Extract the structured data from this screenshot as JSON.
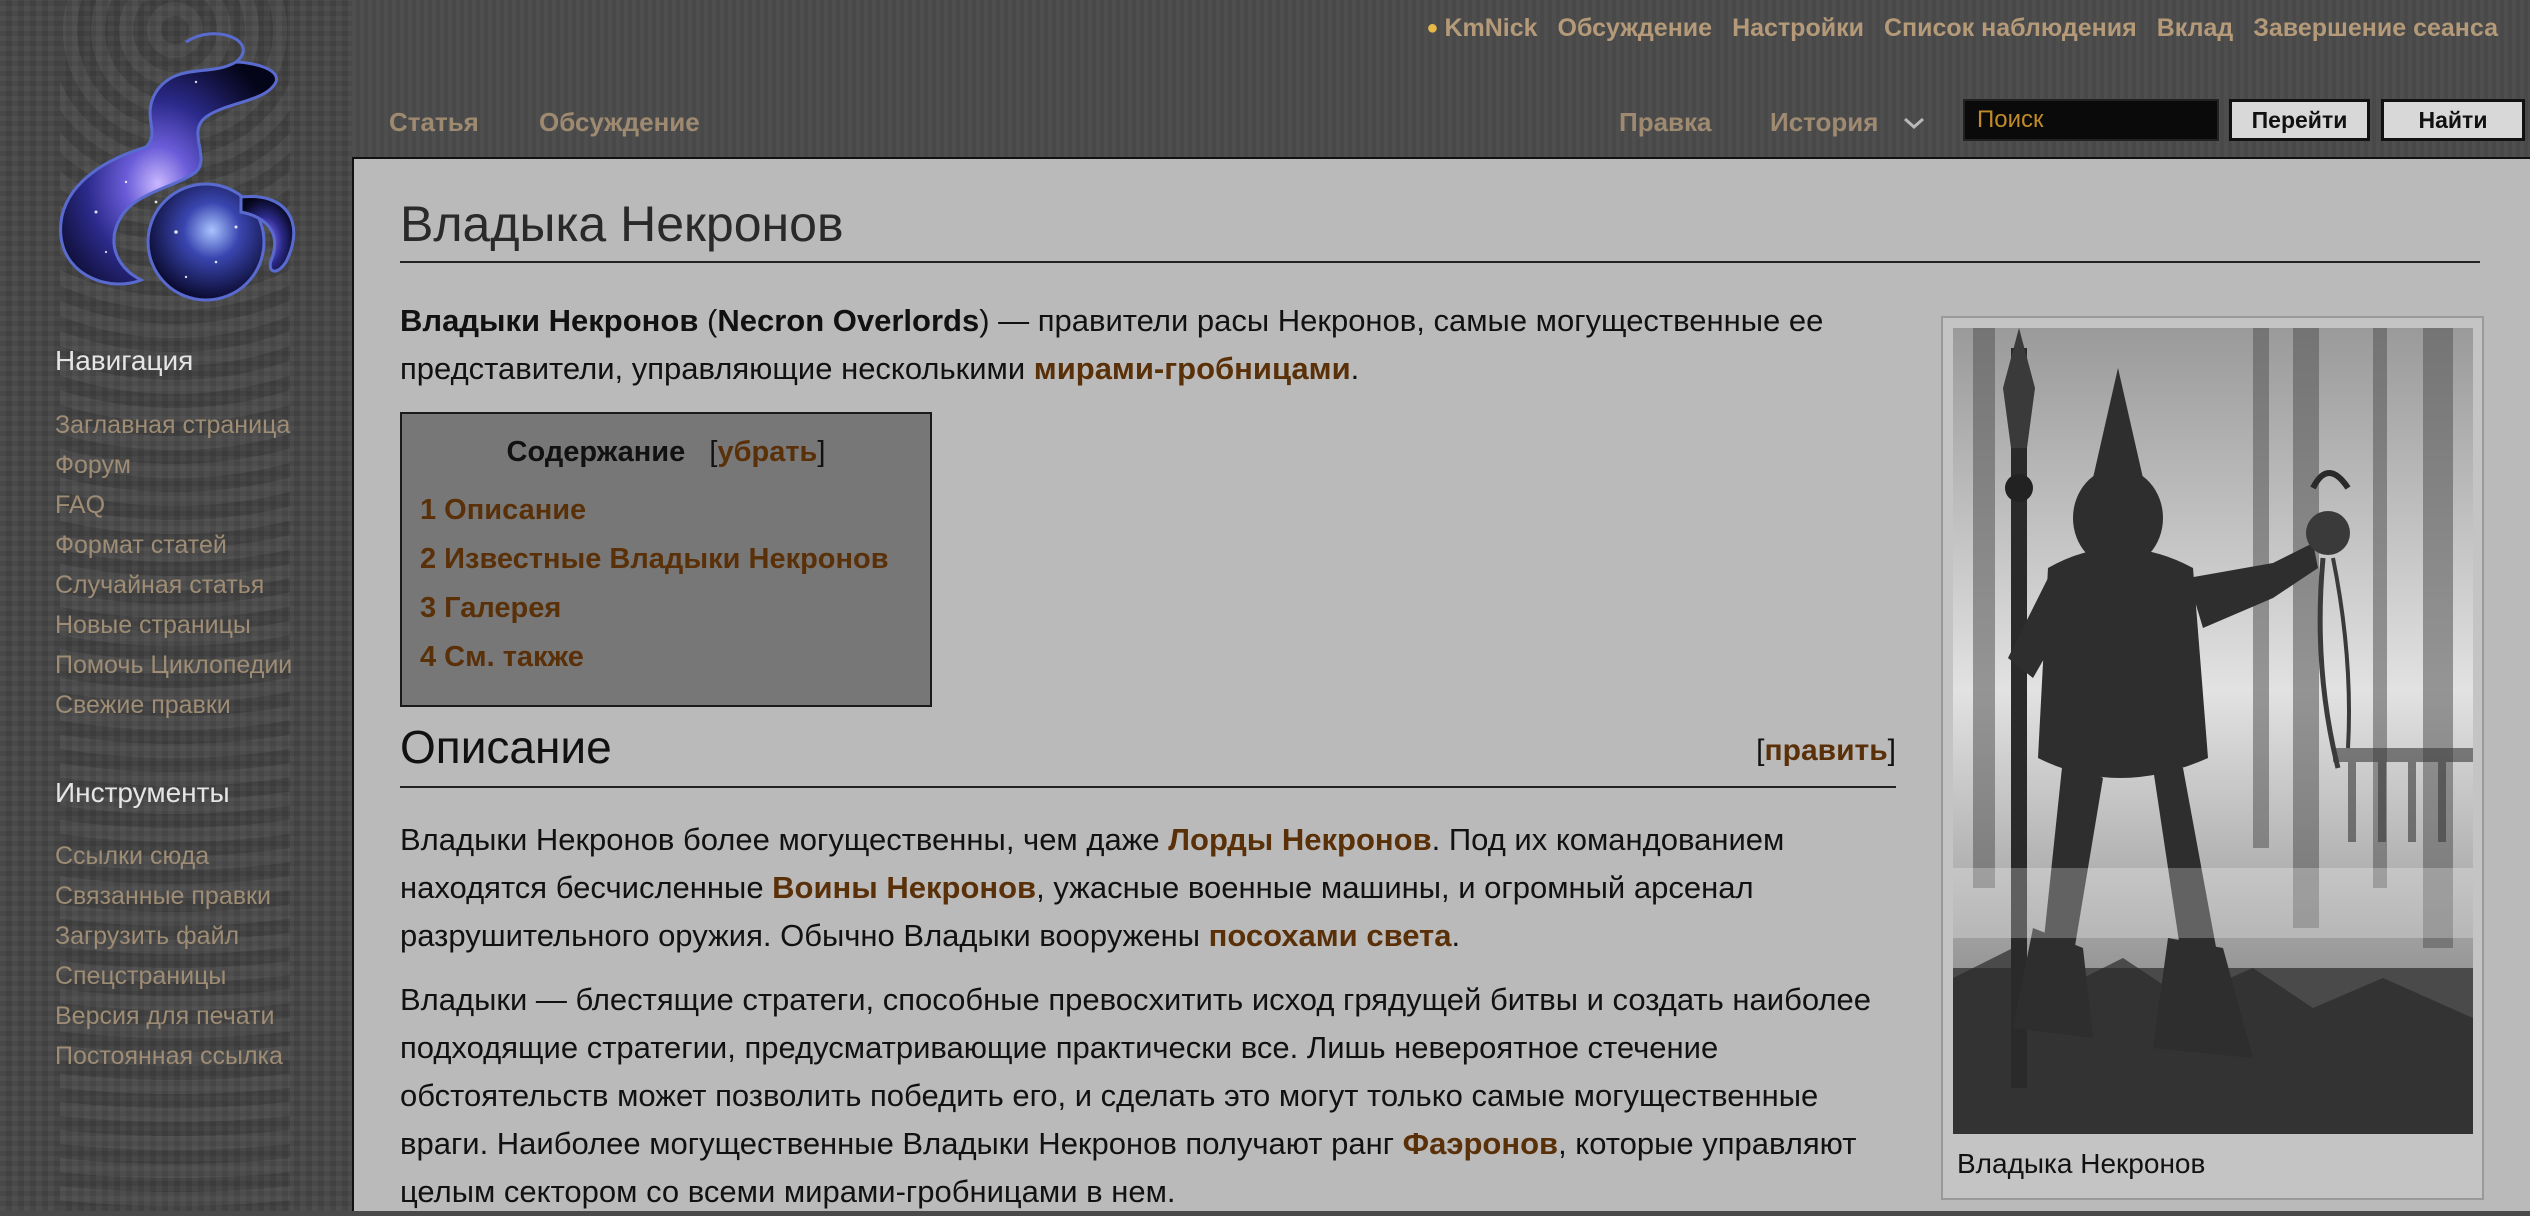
{
  "personal": {
    "username": "KmNick",
    "talk": "Обсуждение",
    "preferences": "Настройки",
    "watchlist": "Список наблюдения",
    "contributions": "Вклад",
    "logout": "Завершение сеанса"
  },
  "tabs": {
    "article": "Статья",
    "discussion": "Обсуждение",
    "edit": "Правка",
    "history": "История"
  },
  "search": {
    "placeholder": "Поиск",
    "go_label": "Перейти",
    "find_label": "Найти"
  },
  "sidebar": {
    "navigation": {
      "title": "Навигация",
      "items": [
        "Заглавная страница",
        "Форум",
        "FAQ",
        "Формат статей",
        "Случайная статья",
        "Новые страницы",
        "Помочь Циклопедии",
        "Свежие правки"
      ]
    },
    "tools": {
      "title": "Инструменты",
      "items": [
        "Ссылки сюда",
        "Связанные правки",
        "Загрузить файл",
        "Спецстраницы",
        "Версия для печати",
        "Постоянная ссылка"
      ]
    }
  },
  "article": {
    "title": "Владыка Некронов",
    "intro": {
      "bold_name": "Владыки Некронов",
      "paren_open": " (",
      "bold_alt": "Necron Overlords",
      "text": ") — правители расы Некронов, самые могущественные ее представители, управляющие несколькими ",
      "link": "мирами-гробницами",
      "end": "."
    },
    "toc": {
      "title": "Содержание",
      "toggle": "убрать",
      "items": [
        "1 Описание",
        "2 Известные Владыки Некронов",
        "3 Галерея",
        "4 См. также"
      ]
    },
    "section": {
      "title": "Описание",
      "edit": "править"
    },
    "para1": {
      "t1": "Владыки Некронов более могущественны, чем даже ",
      "l1": "Лорды Некронов",
      "t2": ". Под их командованием находятся бесчисленные ",
      "l2": "Воины Некронов",
      "t3": ", ужасные военные машины, и огромный арсенал разрушительного оружия. Обычно Владыки вооружены ",
      "l3": "посохами света",
      "t4": "."
    },
    "para2": {
      "t1": "Владыки — блестящие стратеги, способные превосхитить исход грядущей битвы и создать наиболее подходящие стратегии, предусматривающие практически все. Лишь невероятное стечение обстоятельств может позволить победить его, и сделать это могут только самые могущественные враги. Наиболее могущественные Владыки Некронов получают ранг ",
      "l1": "Фаэронов",
      "t2": ", которые управляют целым сектором со всеми мирами-гробницами в нем."
    },
    "thumb": {
      "caption": "Владыка Некронов"
    }
  }
}
